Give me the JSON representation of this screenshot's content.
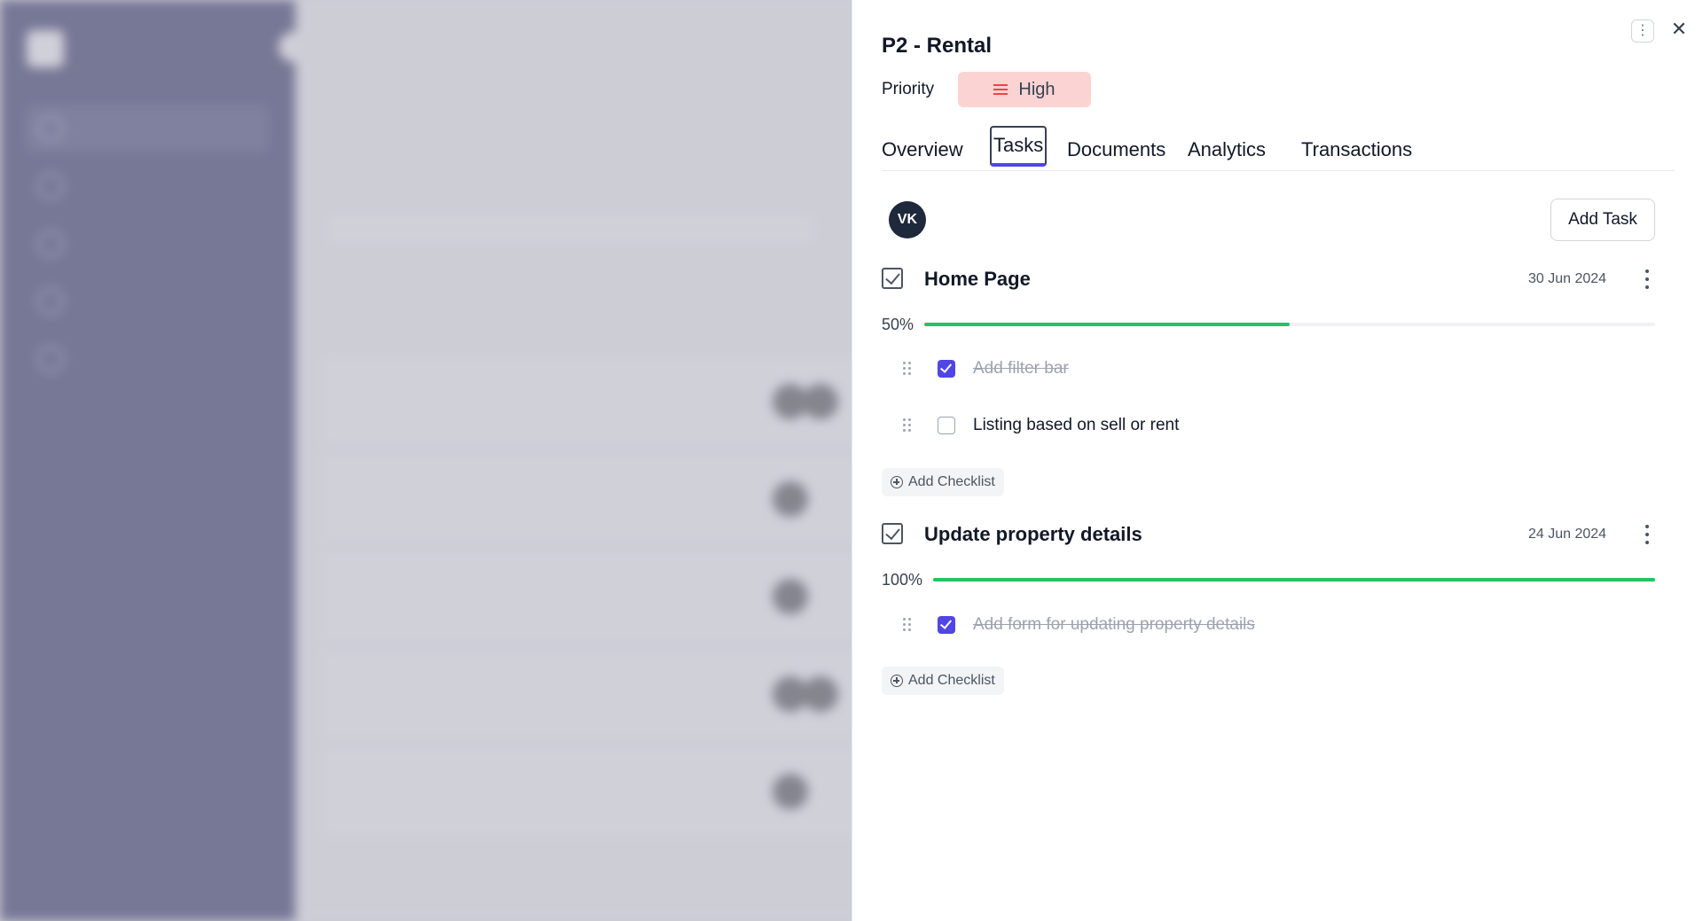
{
  "drawer": {
    "title": "P2 - Rental",
    "priority_label": "Priority",
    "priority_value": "High",
    "priority_color": "#fcd3d3",
    "tabs": [
      "Overview",
      "Tasks",
      "Documents",
      "Analytics",
      "Transactions"
    ],
    "active_tab": "Tasks",
    "avatar_initials": "VK",
    "add_task_label": "Add Task",
    "add_checklist_label": "Add Checklist",
    "accent_color": "#4f46e5",
    "progress_color": "#22c55e"
  },
  "tasks": [
    {
      "title": "Home Page",
      "date": "30 Jun 2024",
      "progress_label": "50%",
      "progress": 0.5,
      "items": [
        {
          "text": "Add filter bar",
          "checked": true
        },
        {
          "text": "Listing based on sell or rent",
          "checked": false
        }
      ]
    },
    {
      "title": "Update property details",
      "date": "24 Jun 2024",
      "progress_label": "100%",
      "progress": 1.0,
      "items": [
        {
          "text": "Add form for updating property details",
          "checked": true
        }
      ]
    }
  ]
}
